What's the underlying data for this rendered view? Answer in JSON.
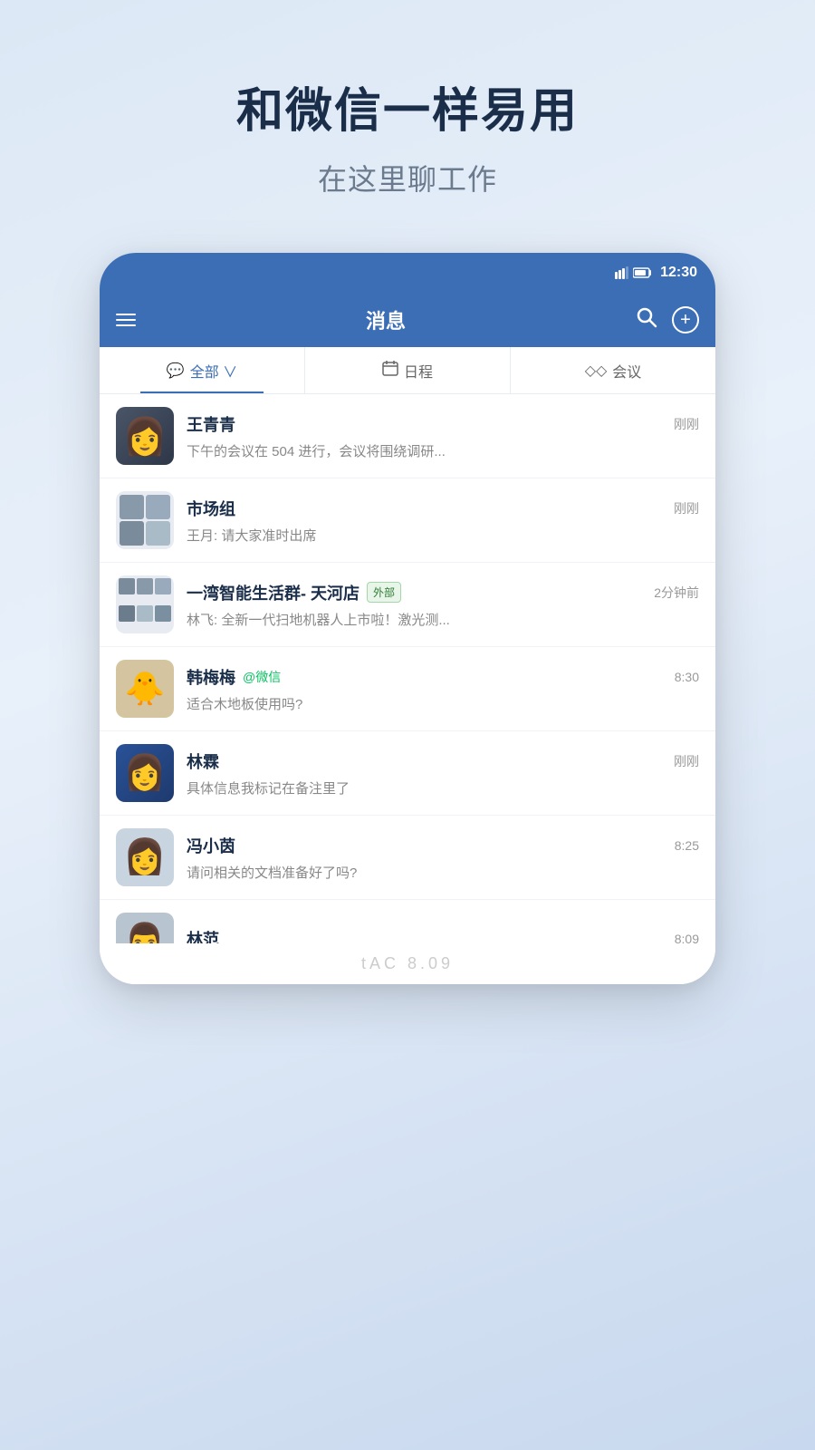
{
  "page": {
    "main_title": "和微信一样易用",
    "sub_title": "在这里聊工作"
  },
  "phone": {
    "status_bar": {
      "time": "12:30"
    },
    "nav_bar": {
      "title": "消息"
    },
    "tabs": [
      {
        "id": "all",
        "label": "全部",
        "icon": "💬",
        "active": true,
        "has_dropdown": true
      },
      {
        "id": "schedule",
        "label": "日程",
        "icon": "📅",
        "active": false
      },
      {
        "id": "meeting",
        "label": "会议",
        "icon": "◇◇",
        "active": false
      }
    ],
    "chats": [
      {
        "id": "wqq",
        "name": "王青青",
        "preview": "下午的会议在 504 进行，会议将围绕调研...",
        "time": "刚刚",
        "avatar_type": "person_female_1"
      },
      {
        "id": "scz",
        "name": "市场组",
        "preview": "王月: 请大家准时出席",
        "time": "刚刚",
        "avatar_type": "group_4",
        "is_group": true
      },
      {
        "id": "ywan",
        "name": "一湾智能生活群- 天河店",
        "preview": "林飞: 全新一代扫地机器人上市啦！激光测...",
        "time": "2分钟前",
        "avatar_type": "group_6",
        "is_group": true,
        "is_external": true,
        "external_label": "外部"
      },
      {
        "id": "hmm",
        "name": "韩梅梅",
        "preview": "适合木地板使用吗?",
        "time": "8:30",
        "avatar_type": "animal",
        "wechat_tag": "@微信"
      },
      {
        "id": "ls",
        "name": "林霖",
        "preview": "具体信息我标记在备注里了",
        "time": "刚刚",
        "avatar_type": "person_female_2"
      },
      {
        "id": "fxy",
        "name": "冯小茵",
        "preview": "请问相关的文档准备好了吗?",
        "time": "8:25",
        "avatar_type": "person_female_3"
      },
      {
        "id": "lf",
        "name": "林范",
        "preview": "",
        "time": "8:09",
        "avatar_type": "person_male_1"
      }
    ]
  },
  "watermark": {
    "text": "tAC 8.09"
  }
}
